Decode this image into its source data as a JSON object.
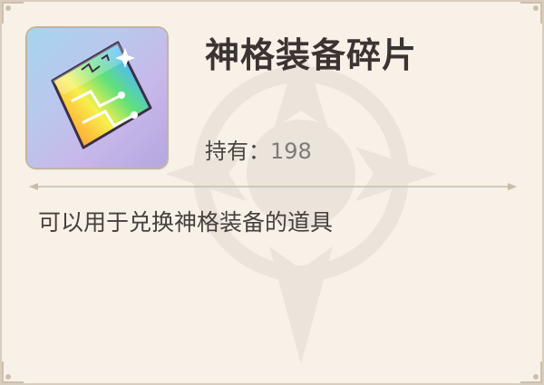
{
  "item": {
    "name": "神格装备碎片",
    "owned_label": "持有：",
    "owned_count": "198",
    "description": "可以用于兑换神格装备的道具",
    "icon": "rainbow-crystal-shard-icon"
  },
  "colors": {
    "panel_bg": "#f7f1e8",
    "title": "#3c3432",
    "count": "#7e7a79"
  }
}
